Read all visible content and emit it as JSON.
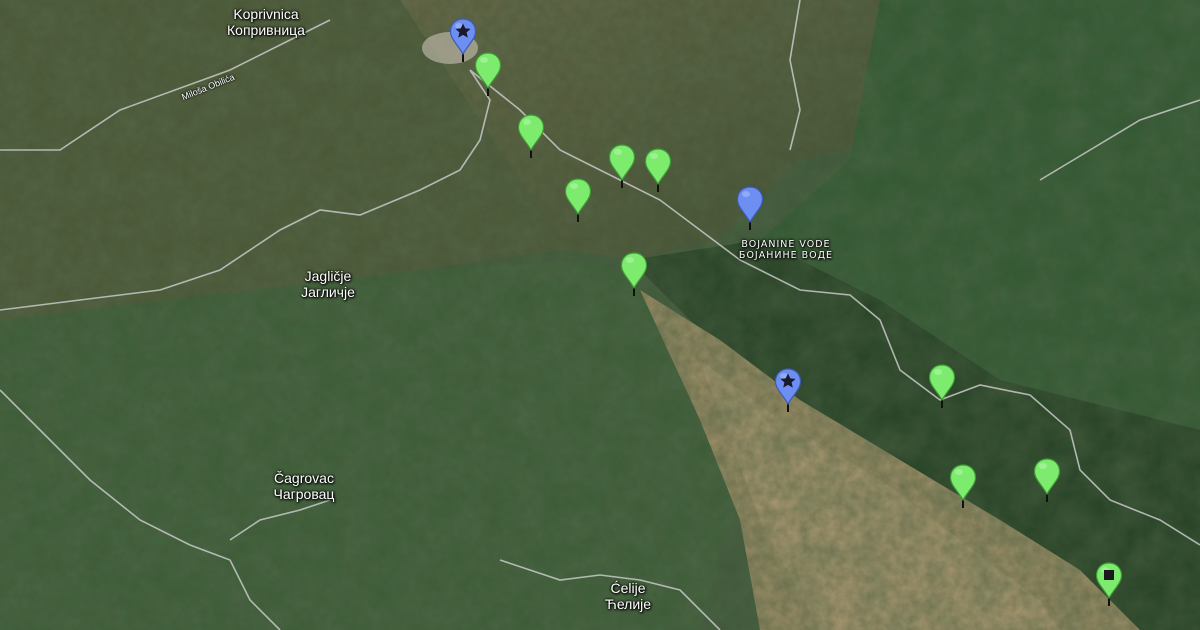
{
  "map": {
    "type": "satellite",
    "colors": {
      "green_marker": "#7dec6e",
      "blue_marker": "#6d8ff2",
      "forest": "#1f3d24",
      "pasture": "#b9a17a",
      "road": "#c8c8c8"
    }
  },
  "places": [
    {
      "id": "koprivnica",
      "latin": "Koprivnica",
      "cyrillic": "Копривница"
    },
    {
      "id": "jaglicje",
      "latin": "Jagličje",
      "cyrillic": "Јагличје"
    },
    {
      "id": "cagrovac",
      "latin": "Čagrovac",
      "cyrillic": "Чагровац"
    },
    {
      "id": "celije",
      "latin": "Ćelije",
      "cyrillic": "Ћелије"
    },
    {
      "id": "bojanine",
      "latin": "BOJANINE VODE",
      "cyrillic": "БОЈАНИНЕ ВОДЕ"
    }
  ],
  "road_labels": [
    {
      "id": "milosa-obilica",
      "text": "Miloša Obilića"
    }
  ],
  "markers": [
    {
      "id": "m1",
      "color": "blue",
      "icon": "star"
    },
    {
      "id": "m2",
      "color": "green",
      "icon": "none"
    },
    {
      "id": "m3",
      "color": "green",
      "icon": "none"
    },
    {
      "id": "m4",
      "color": "green",
      "icon": "none"
    },
    {
      "id": "m5",
      "color": "green",
      "icon": "none"
    },
    {
      "id": "m6",
      "color": "green",
      "icon": "none"
    },
    {
      "id": "m7",
      "color": "blue",
      "icon": "none"
    },
    {
      "id": "m8",
      "color": "green",
      "icon": "none"
    },
    {
      "id": "m9",
      "color": "blue",
      "icon": "star"
    },
    {
      "id": "m10",
      "color": "green",
      "icon": "none"
    },
    {
      "id": "m11",
      "color": "green",
      "icon": "none"
    },
    {
      "id": "m12",
      "color": "green",
      "icon": "none"
    },
    {
      "id": "m13",
      "color": "green",
      "icon": "square"
    }
  ]
}
